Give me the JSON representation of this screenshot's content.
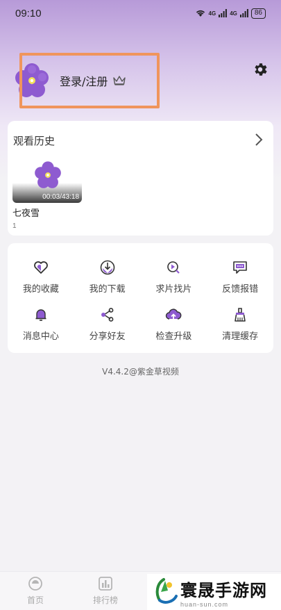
{
  "status_bar": {
    "time": "09:10",
    "network_1": "4G",
    "network_2": "4G",
    "battery": "86"
  },
  "profile": {
    "login_label": "登录/注册"
  },
  "history": {
    "title": "观看历史",
    "items": [
      {
        "title": "七夜雪",
        "duration": "00:03/43:18",
        "subtitle": "1"
      }
    ]
  },
  "features": [
    {
      "label": "我的收藏",
      "icon": "heart-icon"
    },
    {
      "label": "我的下载",
      "icon": "download-icon"
    },
    {
      "label": "求片找片",
      "icon": "search-film-icon"
    },
    {
      "label": "反馈报错",
      "icon": "feedback-icon"
    },
    {
      "label": "消息中心",
      "icon": "bell-icon"
    },
    {
      "label": "分享好友",
      "icon": "share-icon"
    },
    {
      "label": "检查升级",
      "icon": "cloud-upload-icon"
    },
    {
      "label": "清理缓存",
      "icon": "clean-icon"
    }
  ],
  "version": "V4.4.2@紫金草视频",
  "tabs": [
    {
      "label": "首页",
      "icon": "home-icon"
    },
    {
      "label": "排行榜",
      "icon": "ranking-icon"
    }
  ],
  "watermark": {
    "title": "寰晟手游网",
    "url": "huan-sun.com"
  },
  "colors": {
    "accent": "#8e5bd0",
    "highlight": "#f0955c"
  }
}
